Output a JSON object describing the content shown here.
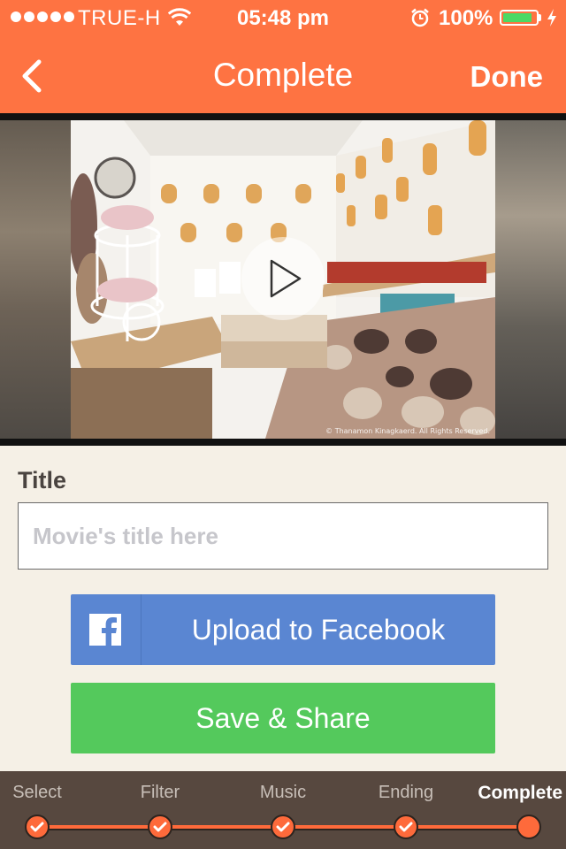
{
  "status_bar": {
    "carrier": "TRUE-H",
    "time": "05:48 pm",
    "battery_percent": "100%",
    "battery_color": "#4cd964"
  },
  "nav": {
    "title": "Complete",
    "done_label": "Done",
    "back_icon": "chevron-left-icon"
  },
  "video": {
    "play_icon": "play-icon",
    "watermark": "© Thanamon Kinagkaerd. All Rights Reserved."
  },
  "title_section": {
    "label": "Title",
    "input_value": "",
    "input_placeholder": "Movie's title here"
  },
  "actions": {
    "facebook_label": "Upload to Facebook",
    "facebook_icon": "facebook-icon",
    "facebook_color": "#5a86d2",
    "save_label": "Save & Share",
    "save_color": "#54c95c"
  },
  "steps": {
    "items": [
      {
        "label": "Select",
        "done": true
      },
      {
        "label": "Filter",
        "done": true
      },
      {
        "label": "Music",
        "done": true
      },
      {
        "label": "Ending",
        "done": true
      },
      {
        "label": "Complete",
        "done": false,
        "current": true
      }
    ],
    "accent_color": "#fe6a3b"
  },
  "theme": {
    "header_color": "#fe7342",
    "background": "#f5f0e6",
    "footer_color": "#57483f"
  }
}
